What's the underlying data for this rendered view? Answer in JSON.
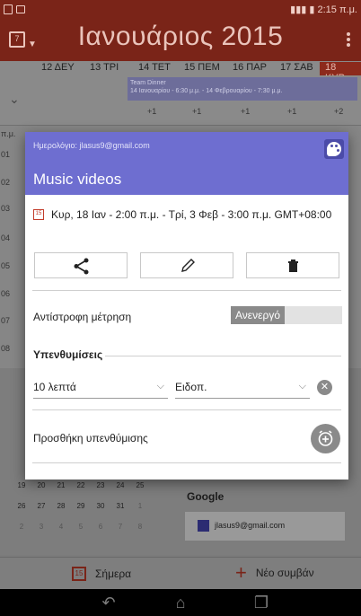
{
  "status": {
    "time": "2:15 π.μ."
  },
  "appbar": {
    "title": "Ιανουάριος 2015",
    "cal_icon": "7"
  },
  "week_days": [
    "12 ΔΕΥ",
    "13 ΤΡΙ",
    "14 ΤΕΤ",
    "15 ΠΕΜ",
    "16 ΠΑΡ",
    "17 ΣΑΒ",
    "18 ΚΥΡ"
  ],
  "allday_event": {
    "title": "Team Dinner",
    "detail": "14 Ιανουαρίου - 6:30 μ.μ. - 14 Φεβρουαρίου - 7:30 μ.μ."
  },
  "plus_counts": [
    "+1",
    "+1",
    "+1",
    "+1",
    "+2"
  ],
  "hours": [
    "π.μ.",
    "01",
    "02",
    "03",
    "04",
    "05",
    "06",
    "07",
    "08"
  ],
  "dialog": {
    "calendar_label": "Ημερολόγιο: jlasus9@gmail.com",
    "event_title": "Music videos",
    "date_range": "Κυρ, 18 Ιαν - 2:00 π.μ. - Τρί, 3 Φεβ - 3:00 π.μ.  GMT+08:00",
    "countdown_label": "Αντίστροφη μέτρηση",
    "countdown_value": "Ανενεργό",
    "reminders_heading": "Υπενθυμίσεις",
    "reminder_time": "10 λεπτά",
    "reminder_type": "Ειδοπ.",
    "add_reminder": "Προσθήκη υπενθύμισης"
  },
  "minical": [
    [
      "19",
      "20",
      "21",
      "22",
      "23",
      "24",
      "25"
    ],
    [
      "26",
      "27",
      "28",
      "29",
      "30",
      "31",
      "1"
    ],
    [
      "2",
      "3",
      "4",
      "5",
      "6",
      "7",
      "8"
    ]
  ],
  "accounts": {
    "heading": "Google",
    "email": "jlasus9@gmail.com"
  },
  "bottom": {
    "today": "Σήμερα",
    "new_event": "Νέο συμβάν"
  },
  "colors": {
    "accent": "#7a2418",
    "dialog_header": "#6e6ed0"
  }
}
